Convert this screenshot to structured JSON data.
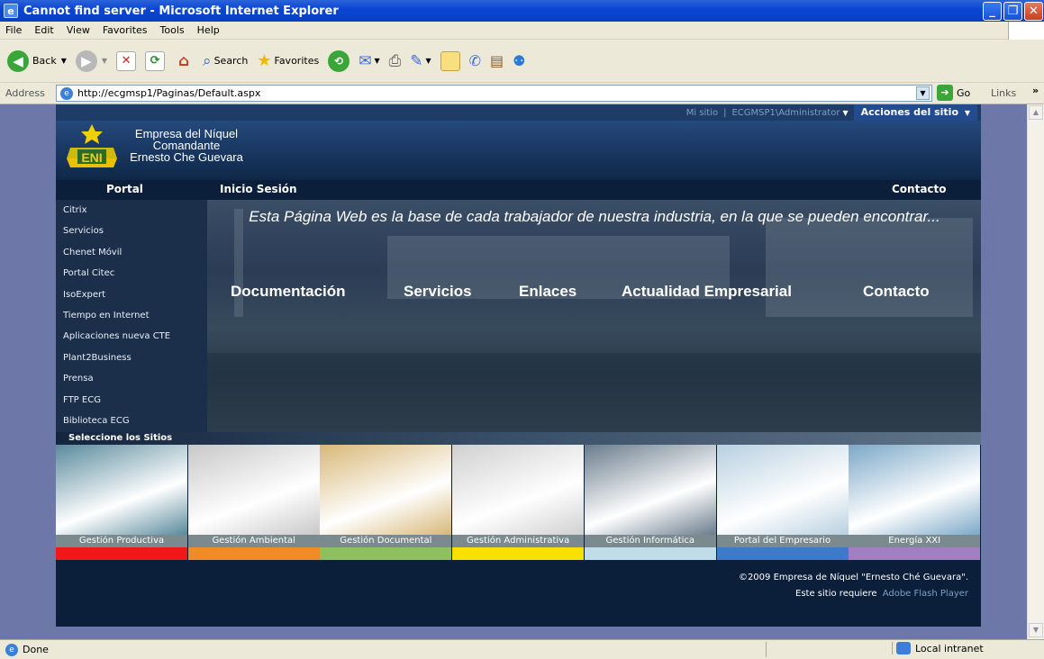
{
  "window": {
    "title": "Cannot find server - Microsoft Internet Explorer"
  },
  "menu": [
    "File",
    "Edit",
    "View",
    "Favorites",
    "Tools",
    "Help"
  ],
  "toolbar": {
    "back": "Back",
    "search": "Search",
    "favorites": "Favorites"
  },
  "address": {
    "label": "Address",
    "url": "http://ecgmsp1/Paginas/Default.aspx",
    "go": "Go",
    "links": "Links"
  },
  "site": {
    "mi_sitio": "Mi sitio",
    "separator": "|",
    "user": "ECGMSP1\\Administrator",
    "acciones": "Acciones del sitio",
    "logo_lines": [
      "Empresa del Níquel",
      "Comandante",
      "Ernesto Che Guevara"
    ],
    "nav": {
      "portal": "Portal",
      "inicio": "Inicio Sesión",
      "contacto": "Contacto"
    },
    "sidebar": [
      "Citrix",
      "Servicios",
      "Chenet Móvil",
      "Portal Citec",
      "IsoExpert",
      "Tiempo en Internet",
      "Aplicaciones nueva CTE",
      "Plant2Business",
      "Prensa",
      "FTP ECG",
      "Biblioteca ECG"
    ],
    "hero_text": "Esta Página Web es la base de cada trabajador de nuestra industria, en la que se pueden encontrar...",
    "hero_links": [
      "Documentación",
      "Servicios",
      "Enlaces",
      "Actualidad Empresarial",
      "Contacto"
    ],
    "select_sites": "Seleccione los Sitios",
    "tiles": [
      {
        "label": "Gestión Productiva",
        "bar": "#f01818",
        "img": "#5a8a9c"
      },
      {
        "label": "Gestión Ambiental",
        "bar": "#f08c28",
        "img": "#c8c8c8"
      },
      {
        "label": "Gestión Documental",
        "bar": "#8ec060",
        "img": "#d8b878"
      },
      {
        "label": "Gestión Administrativa",
        "bar": "#f8e000",
        "img": "#d0d0d0"
      },
      {
        "label": "Gestión Informática",
        "bar": "#c0dce8",
        "img": "#6a7c8c"
      },
      {
        "label": "Portal del Empresario",
        "bar": "#3e7ac8",
        "img": "#b8d0e0"
      },
      {
        "label": "Energía XXI",
        "bar": "#a080c0",
        "img": "#7ca8c8"
      }
    ],
    "footer_copyright": "©2009 Empresa de Níquel \"Ernesto Ché Guevara\".",
    "footer_requires": "Este sitio requiere",
    "footer_flash": "Adobe Flash Player"
  },
  "status": {
    "done": "Done",
    "zone": "Local intranet"
  }
}
